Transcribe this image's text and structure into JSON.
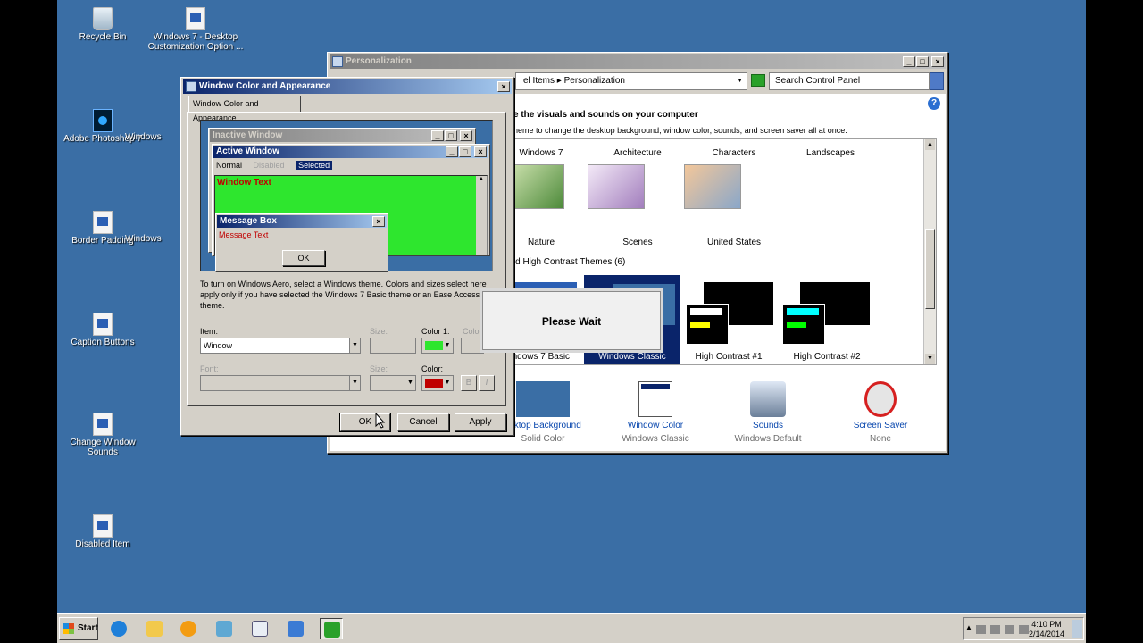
{
  "desktop_icons": [
    {
      "id": "recycle-bin",
      "label": "Recycle Bin",
      "icon": "recycle-bin-icon"
    },
    {
      "id": "win7-custom",
      "label": "Windows 7 - Desktop Customization Option ...",
      "icon": "document-icon"
    },
    {
      "id": "photoshop",
      "label": "Adobe Photoshop 7",
      "icon": "photoshop-icon"
    },
    {
      "id": "windows-2",
      "label": "Windows",
      "icon": "document-icon"
    },
    {
      "id": "border-padding",
      "label": "Border Padding",
      "icon": "document-icon"
    },
    {
      "id": "windows-3",
      "label": "Windows",
      "icon": "document-icon"
    },
    {
      "id": "caption-buttons",
      "label": "Caption Buttons",
      "icon": "document-icon"
    },
    {
      "id": "change-sounds",
      "label": "Change Window Sounds",
      "icon": "document-icon"
    },
    {
      "id": "disabled-item",
      "label": "Disabled Item",
      "icon": "document-icon"
    }
  ],
  "personalization": {
    "title": "Personalization",
    "address": "el Items  ▸  Personalization",
    "search_placeholder": "Search Control Panel",
    "heading": "e the visuals and sounds on your computer",
    "subheading": "heme to change the desktop background, window color, sounds, and screen saver all at once.",
    "aero_themes": [
      "Windows 7",
      "Architecture",
      "Characters",
      "Landscapes",
      "Nature",
      "Scenes",
      "United States"
    ],
    "basic_section": "and High Contrast Themes (6)",
    "basic_themes": [
      "Windows 7 Basic",
      "Windows Classic",
      "High Contrast #1",
      "High Contrast #2"
    ],
    "selected_theme": "Windows Classic",
    "bottom_items": [
      {
        "label": "esktop Background",
        "sub": "Solid Color"
      },
      {
        "label": "Window Color",
        "sub": "Windows Classic"
      },
      {
        "label": "Sounds",
        "sub": "Windows Default"
      },
      {
        "label": "Screen Saver",
        "sub": "None"
      }
    ]
  },
  "wca": {
    "title": "Window Color and Appearance",
    "tab": "Window Color and Appearance",
    "preview": {
      "inactive_title": "Inactive Window",
      "active_title": "Active Window",
      "menu_normal": "Normal",
      "menu_disabled": "Disabled",
      "menu_selected": "Selected",
      "window_text": "Window Text",
      "msgbox_title": "Message Box",
      "msg_text": "Message Text",
      "ok": "OK"
    },
    "description": "To turn on Windows Aero, select a Windows theme.  Colors and sizes select here apply only if you have selected the Windows 7 Basic theme or an Ease Access theme.",
    "item_label": "Item:",
    "item_value": "Window",
    "size_label": "Size:",
    "color1_label": "Color 1:",
    "color2_label": "Color",
    "font_label": "Font:",
    "size2_label": "Size:",
    "color_label": "Color:",
    "color1_hex": "#2ee62e",
    "font_color_hex": "#c00000",
    "bold_label": "B",
    "italic_label": "I",
    "ok": "OK",
    "cancel": "Cancel",
    "apply": "Apply"
  },
  "wait": {
    "text": "Please Wait"
  },
  "taskbar": {
    "start": "Start",
    "time": "4:10 PM",
    "date": "2/14/2014"
  }
}
